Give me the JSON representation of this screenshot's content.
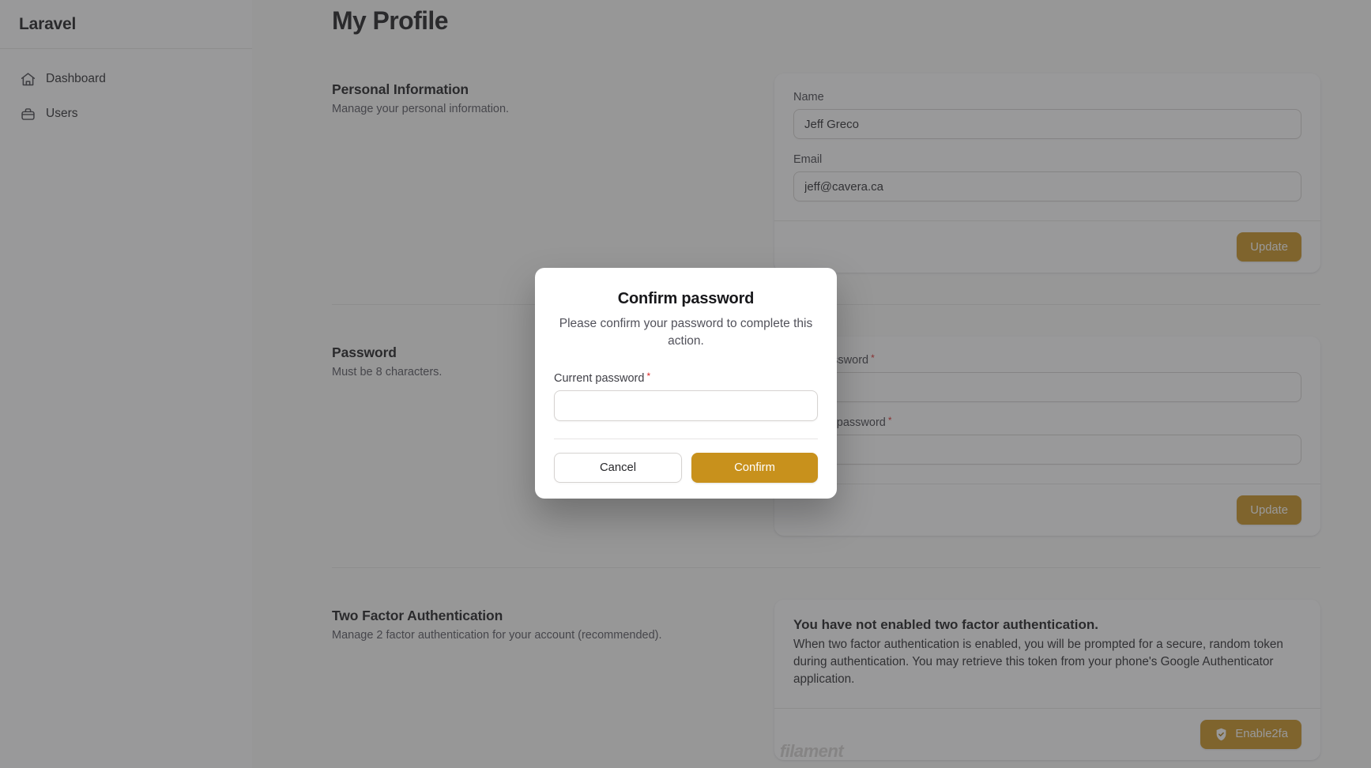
{
  "sidebar": {
    "brand": "Laravel",
    "items": [
      {
        "label": "Dashboard",
        "icon": "home-icon"
      },
      {
        "label": "Users",
        "icon": "briefcase-icon"
      }
    ]
  },
  "page": {
    "title": "My Profile",
    "footer_brand": "filament"
  },
  "sections": {
    "personal": {
      "title": "Personal Information",
      "subtitle": "Manage your personal information.",
      "fields": {
        "name_label": "Name",
        "name_value": "Jeff Greco",
        "email_label": "Email",
        "email_value": "jeff@cavera.ca"
      },
      "update_label": "Update"
    },
    "password": {
      "title": "Password",
      "subtitle": "Must be 8 characters.",
      "fields": {
        "new_label": "New password",
        "new_value": "",
        "new_required": "*",
        "confirm_label": "Confirm password",
        "confirm_value": "",
        "confirm_required": "*"
      },
      "update_label": "Update"
    },
    "two_factor": {
      "title": "Two Factor Authentication",
      "subtitle": "Manage 2 factor authentication for your account (recommended).",
      "status_heading": "You have not enabled two factor authentication.",
      "status_body": "When two factor authentication is enabled, you will be prompted for a secure, random token during authentication. You may retrieve this token from your phone's Google Authenticator application.",
      "enable_label": "Enable2fa",
      "enable_icon": "shield-check-icon"
    }
  },
  "modal": {
    "title": "Confirm password",
    "subtitle": "Please confirm your password to complete this action.",
    "field_label": "Current password",
    "field_required": "*",
    "field_value": "",
    "cancel_label": "Cancel",
    "confirm_label": "Confirm"
  },
  "colors": {
    "accent": "#c8911c",
    "required": "#dc2626",
    "text": "#18181b",
    "muted": "#52525b",
    "border": "#e7e5e4"
  }
}
